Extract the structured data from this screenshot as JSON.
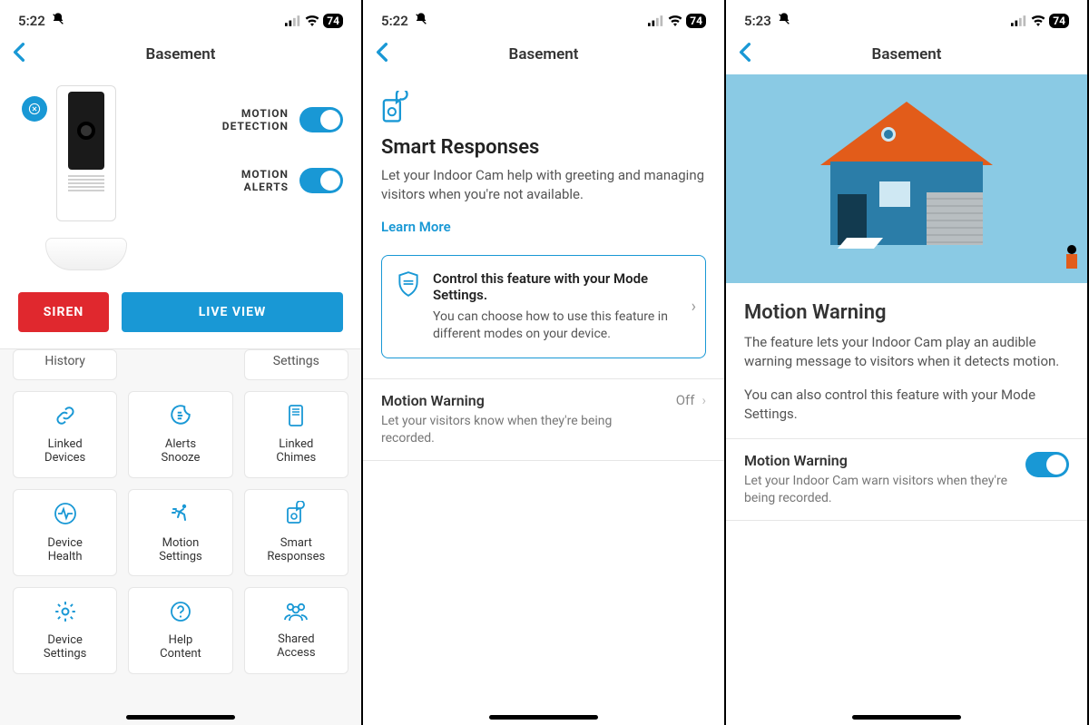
{
  "status": {
    "panel1_time": "5:22",
    "panel2_time": "5:22",
    "panel3_time": "5:23",
    "battery": "74"
  },
  "nav": {
    "title": "Basement"
  },
  "panel1": {
    "motion_detection_label": "MOTION\nDETECTION",
    "motion_alerts_label": "MOTION\nALERTS",
    "motion_detection_on": true,
    "motion_alerts_on": true,
    "siren_label": "SIREN",
    "live_view_label": "LIVE VIEW",
    "tiles_cut_left": "History",
    "tiles_cut_right": "Settings",
    "tiles": [
      {
        "label": "Linked\nDevices",
        "icon": "link"
      },
      {
        "label": "Alerts\nSnooze",
        "icon": "snooze"
      },
      {
        "label": "Linked\nChimes",
        "icon": "chime"
      },
      {
        "label": "Device\nHealth",
        "icon": "health"
      },
      {
        "label": "Motion\nSettings",
        "icon": "runner"
      },
      {
        "label": "Smart\nResponses",
        "icon": "smartresp"
      },
      {
        "label": "Device\nSettings",
        "icon": "gear"
      },
      {
        "label": "Help\nContent",
        "icon": "help"
      },
      {
        "label": "Shared\nAccess",
        "icon": "people"
      }
    ]
  },
  "panel2": {
    "title": "Smart Responses",
    "description": "Let your Indoor Cam help with greeting and managing visitors when you're not available.",
    "learn_more": "Learn More",
    "mode_card_title": "Control this feature with your Mode Settings.",
    "mode_card_desc": "You can choose how to use this feature in different modes on your device.",
    "mw_title": "Motion Warning",
    "mw_value": "Off",
    "mw_desc": "Let your visitors know when they're being recorded."
  },
  "panel3": {
    "title": "Motion Warning",
    "desc1": "The feature lets your Indoor Cam play an audible warning message to visitors when it detects motion.",
    "desc2": "You can also control this feature with your Mode Settings.",
    "row_title": "Motion Warning",
    "row_desc": "Let your Indoor Cam warn visitors when they're being recorded.",
    "row_toggle_on": true
  }
}
